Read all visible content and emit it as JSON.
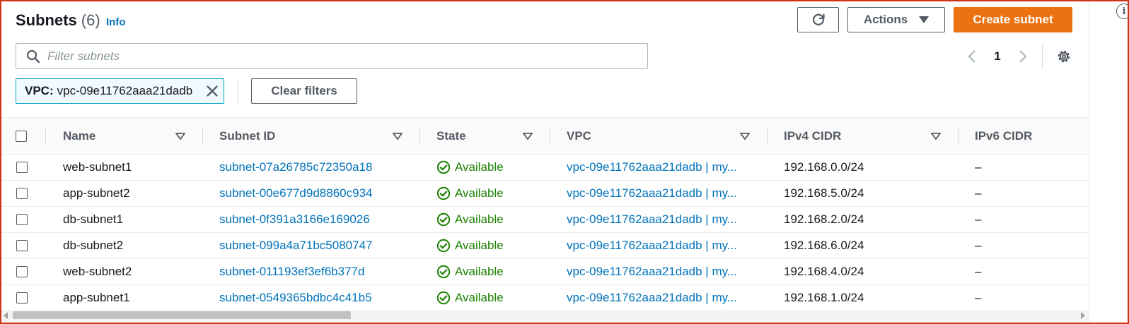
{
  "header": {
    "title": "Subnets",
    "count": "(6)",
    "info_label": "Info"
  },
  "toolbar": {
    "refresh_icon": "refresh-icon",
    "actions_label": "Actions",
    "create_label": "Create subnet"
  },
  "search": {
    "placeholder": "Filter subnets",
    "value": ""
  },
  "pagination": {
    "current_page": "1"
  },
  "filter_chip": {
    "key": "VPC:",
    "value": "vpc-09e11762aaa21dadb"
  },
  "clear_filters_label": "Clear filters",
  "table": {
    "columns": [
      "Name",
      "Subnet ID",
      "State",
      "VPC",
      "IPv4 CIDR",
      "IPv6 CIDR"
    ],
    "rows": [
      {
        "name": "web-subnet1",
        "subnet_id": "subnet-07a26785c72350a18",
        "state": "Available",
        "vpc": "vpc-09e11762aaa21dadb | my...",
        "ipv4": "192.168.0.0/24",
        "ipv6": "–"
      },
      {
        "name": "app-subnet2",
        "subnet_id": "subnet-00e677d9d8860c934",
        "state": "Available",
        "vpc": "vpc-09e11762aaa21dadb | my...",
        "ipv4": "192.168.5.0/24",
        "ipv6": "–"
      },
      {
        "name": "db-subnet1",
        "subnet_id": "subnet-0f391a3166e169026",
        "state": "Available",
        "vpc": "vpc-09e11762aaa21dadb | my...",
        "ipv4": "192.168.2.0/24",
        "ipv6": "–"
      },
      {
        "name": "db-subnet2",
        "subnet_id": "subnet-099a4a71bc5080747",
        "state": "Available",
        "vpc": "vpc-09e11762aaa21dadb | my...",
        "ipv4": "192.168.6.0/24",
        "ipv6": "–"
      },
      {
        "name": "web-subnet2",
        "subnet_id": "subnet-011193ef3ef6b377d",
        "state": "Available",
        "vpc": "vpc-09e11762aaa21dadb | my...",
        "ipv4": "192.168.4.0/24",
        "ipv6": "–"
      },
      {
        "name": "app-subnet1",
        "subnet_id": "subnet-0549365bdbc4c41b5",
        "state": "Available",
        "vpc": "vpc-09e11762aaa21dadb | my...",
        "ipv4": "192.168.1.0/24",
        "ipv6": "–"
      }
    ]
  },
  "colors": {
    "primary": "#ec7211",
    "link": "#0073bb",
    "success": "#1d8102"
  }
}
